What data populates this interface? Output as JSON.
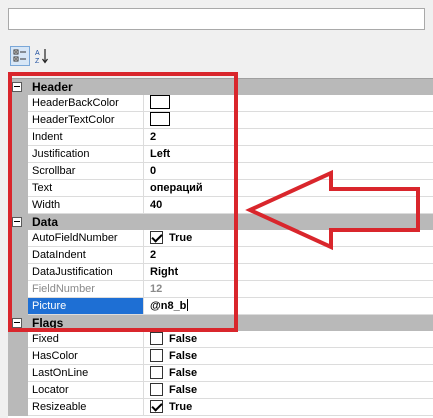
{
  "header_box": {
    "value": ""
  },
  "toolbar": {
    "categorized_icon": "categorized-icon",
    "alphabetical_icon": "alphabetical-sort-icon"
  },
  "annotation_color": "#d9262c",
  "categories": [
    {
      "label": "Header",
      "rows": [
        {
          "name": "HeaderBackColor",
          "type": "color",
          "value": ""
        },
        {
          "name": "HeaderTextColor",
          "type": "color",
          "value": ""
        },
        {
          "name": "Indent",
          "type": "text",
          "value": "2"
        },
        {
          "name": "Justification",
          "type": "text",
          "value": "Left"
        },
        {
          "name": "Scrollbar",
          "type": "text",
          "value": "0"
        },
        {
          "name": "Text",
          "type": "text",
          "value": "операций"
        },
        {
          "name": "Width",
          "type": "text",
          "value": "40"
        }
      ]
    },
    {
      "label": "Data",
      "rows": [
        {
          "name": "AutoFieldNumber",
          "type": "bool",
          "checked": true,
          "value": "True"
        },
        {
          "name": "DataIndent",
          "type": "text",
          "value": "2"
        },
        {
          "name": "DataJustification",
          "type": "text",
          "value": "Right"
        },
        {
          "name": "FieldNumber",
          "type": "text",
          "value": "12",
          "readonly": true
        },
        {
          "name": "Picture",
          "type": "text",
          "value": "@n8_b",
          "selected": true
        }
      ]
    },
    {
      "label": "Flags",
      "rows": [
        {
          "name": "Fixed",
          "type": "bool",
          "checked": false,
          "value": "False"
        },
        {
          "name": "HasColor",
          "type": "bool",
          "checked": false,
          "value": "False"
        },
        {
          "name": "LastOnLine",
          "type": "bool",
          "checked": false,
          "value": "False"
        },
        {
          "name": "Locator",
          "type": "bool",
          "checked": false,
          "value": "False"
        },
        {
          "name": "Resizeable",
          "type": "bool",
          "checked": true,
          "value": "True"
        }
      ]
    }
  ]
}
